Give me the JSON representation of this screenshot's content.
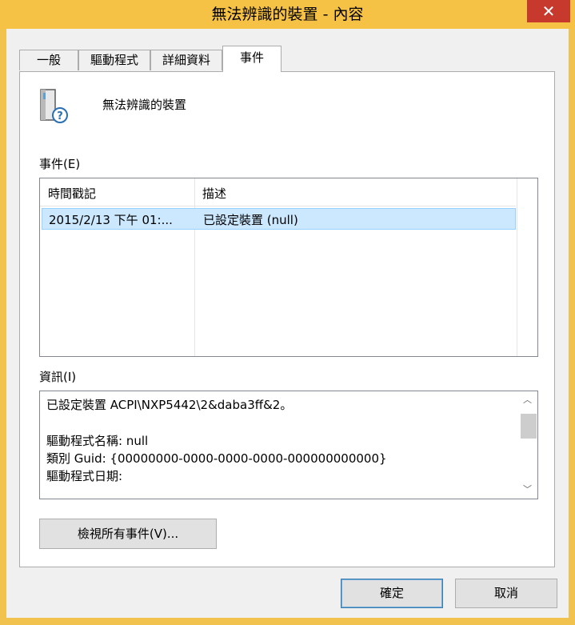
{
  "window": {
    "title": "無法辨識的裝置 - 內容",
    "close_glyph": "✕"
  },
  "tabs": [
    {
      "label": "一般",
      "active": false
    },
    {
      "label": "驅動程式",
      "active": false
    },
    {
      "label": "詳細資料",
      "active": false
    },
    {
      "label": "事件",
      "active": true
    }
  ],
  "device": {
    "name": "無法辨識的裝置",
    "icon": "unknown-device-icon"
  },
  "events": {
    "label": "事件(E)",
    "columns": [
      "時間戳記",
      "描述"
    ],
    "rows": [
      {
        "timestamp": "2015/2/13 下午 01:...",
        "description": "已設定裝置 (null)"
      }
    ]
  },
  "info": {
    "label": "資訊(I)",
    "lines": [
      "已設定裝置 ACPI\\NXP5442\\2&daba3ff&2。",
      "",
      "驅動程式名稱: null",
      "類別 Guid: {00000000-0000-0000-0000-000000000000}",
      "驅動程式日期:"
    ],
    "scroll_up_glyph": "︿",
    "scroll_down_glyph": "﹀"
  },
  "buttons": {
    "view_all": "檢視所有事件(V)...",
    "ok": "確定",
    "cancel": "取消"
  },
  "colors": {
    "title_bar": "#f6c245",
    "close": "#c7382d",
    "selection": "#cce8ff"
  }
}
